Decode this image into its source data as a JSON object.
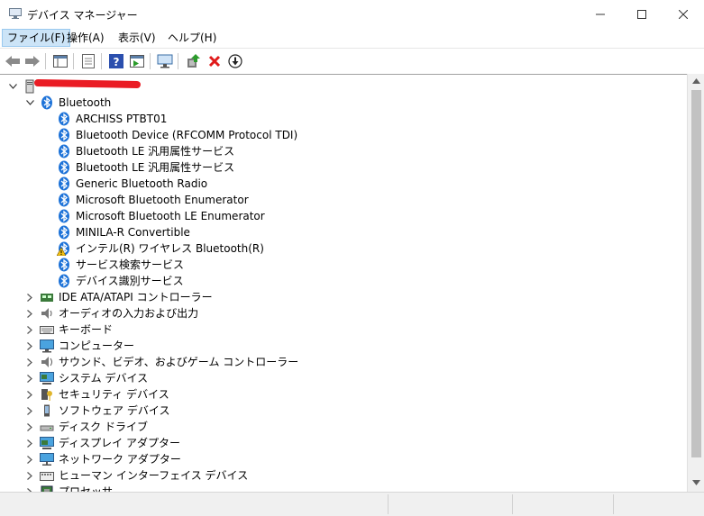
{
  "window": {
    "title": "デバイス マネージャー"
  },
  "menu": [
    "ファイル(F)",
    "操作(A)",
    "表示(V)",
    "ヘルプ(H)"
  ],
  "tree": {
    "bluetooth": {
      "label": "Bluetooth",
      "children": [
        "ARCHISS PTBT01",
        "Bluetooth Device (RFCOMM Protocol TDI)",
        "Bluetooth LE 汎用属性サービス",
        "Bluetooth LE 汎用属性サービス",
        "Generic Bluetooth Radio",
        "Microsoft Bluetooth Enumerator",
        "Microsoft Bluetooth LE Enumerator",
        "MINILA-R Convertible",
        "インテル(R) ワイヤレス Bluetooth(R)",
        "サービス検索サービス",
        "デバイス識別サービス"
      ]
    },
    "categories": [
      "IDE ATA/ATAPI コントローラー",
      "オーディオの入力および出力",
      "キーボード",
      "コンピューター",
      "サウンド、ビデオ、およびゲーム コントローラー",
      "システム デバイス",
      "セキュリティ デバイス",
      "ソフトウェア デバイス",
      "ディスク ドライブ",
      "ディスプレイ アダプター",
      "ネットワーク アダプター",
      "ヒューマン インターフェイス デバイス",
      "プロセッサ"
    ]
  },
  "colors": {
    "bluetooth": "#1e73d8",
    "warning": "#f5c211",
    "delete": "#e01b1b",
    "redaction": "#ea1c24"
  }
}
